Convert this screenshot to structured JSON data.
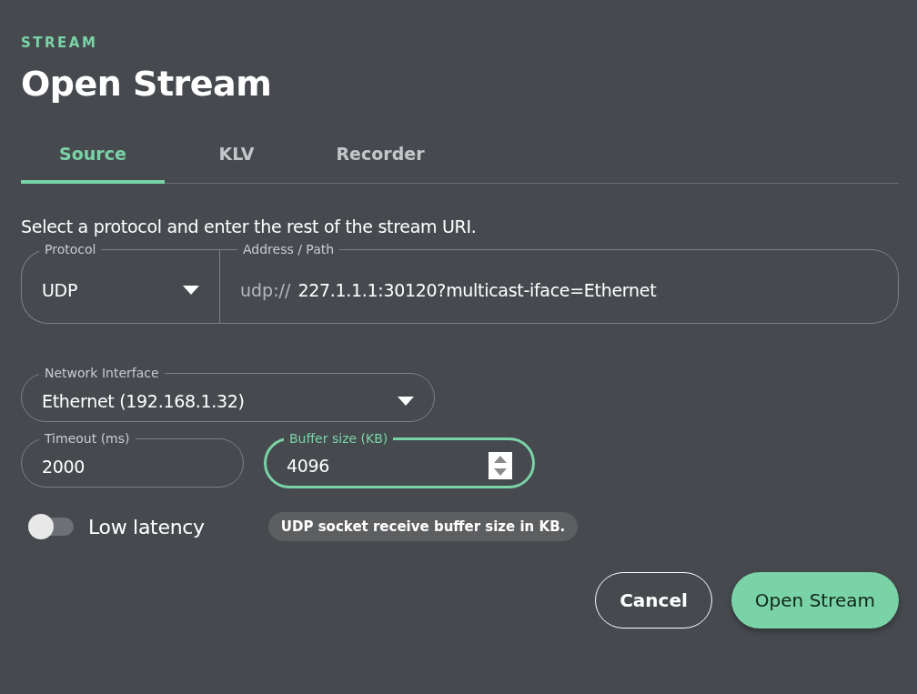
{
  "eyebrow": "STREAM",
  "title": "Open Stream",
  "tabs": [
    {
      "label": "Source",
      "selected": true
    },
    {
      "label": "KLV",
      "selected": false
    },
    {
      "label": "Recorder",
      "selected": false
    }
  ],
  "description": "Select a protocol and enter the rest of the stream URI.",
  "protocol": {
    "label": "Protocol",
    "value": "UDP"
  },
  "address": {
    "label": "Address / Path",
    "prefix": "udp://",
    "value": "227.1.1.1:30120?multicast-iface=Ethernet"
  },
  "network_interface": {
    "label": "Network Interface",
    "value": "Ethernet (192.168.1.32)"
  },
  "timeout": {
    "label": "Timeout (ms)",
    "value": "2000",
    "focused": false
  },
  "buffer_size": {
    "label": "Buffer size (KB)",
    "value": "4096",
    "focused": true
  },
  "low_latency": {
    "label": "Low latency",
    "on": false
  },
  "tooltip": "UDP socket receive buffer size in KB.",
  "buttons": [
    {
      "label": "Cancel",
      "kind": "secondary"
    },
    {
      "label": "Open Stream",
      "kind": "primary"
    }
  ]
}
